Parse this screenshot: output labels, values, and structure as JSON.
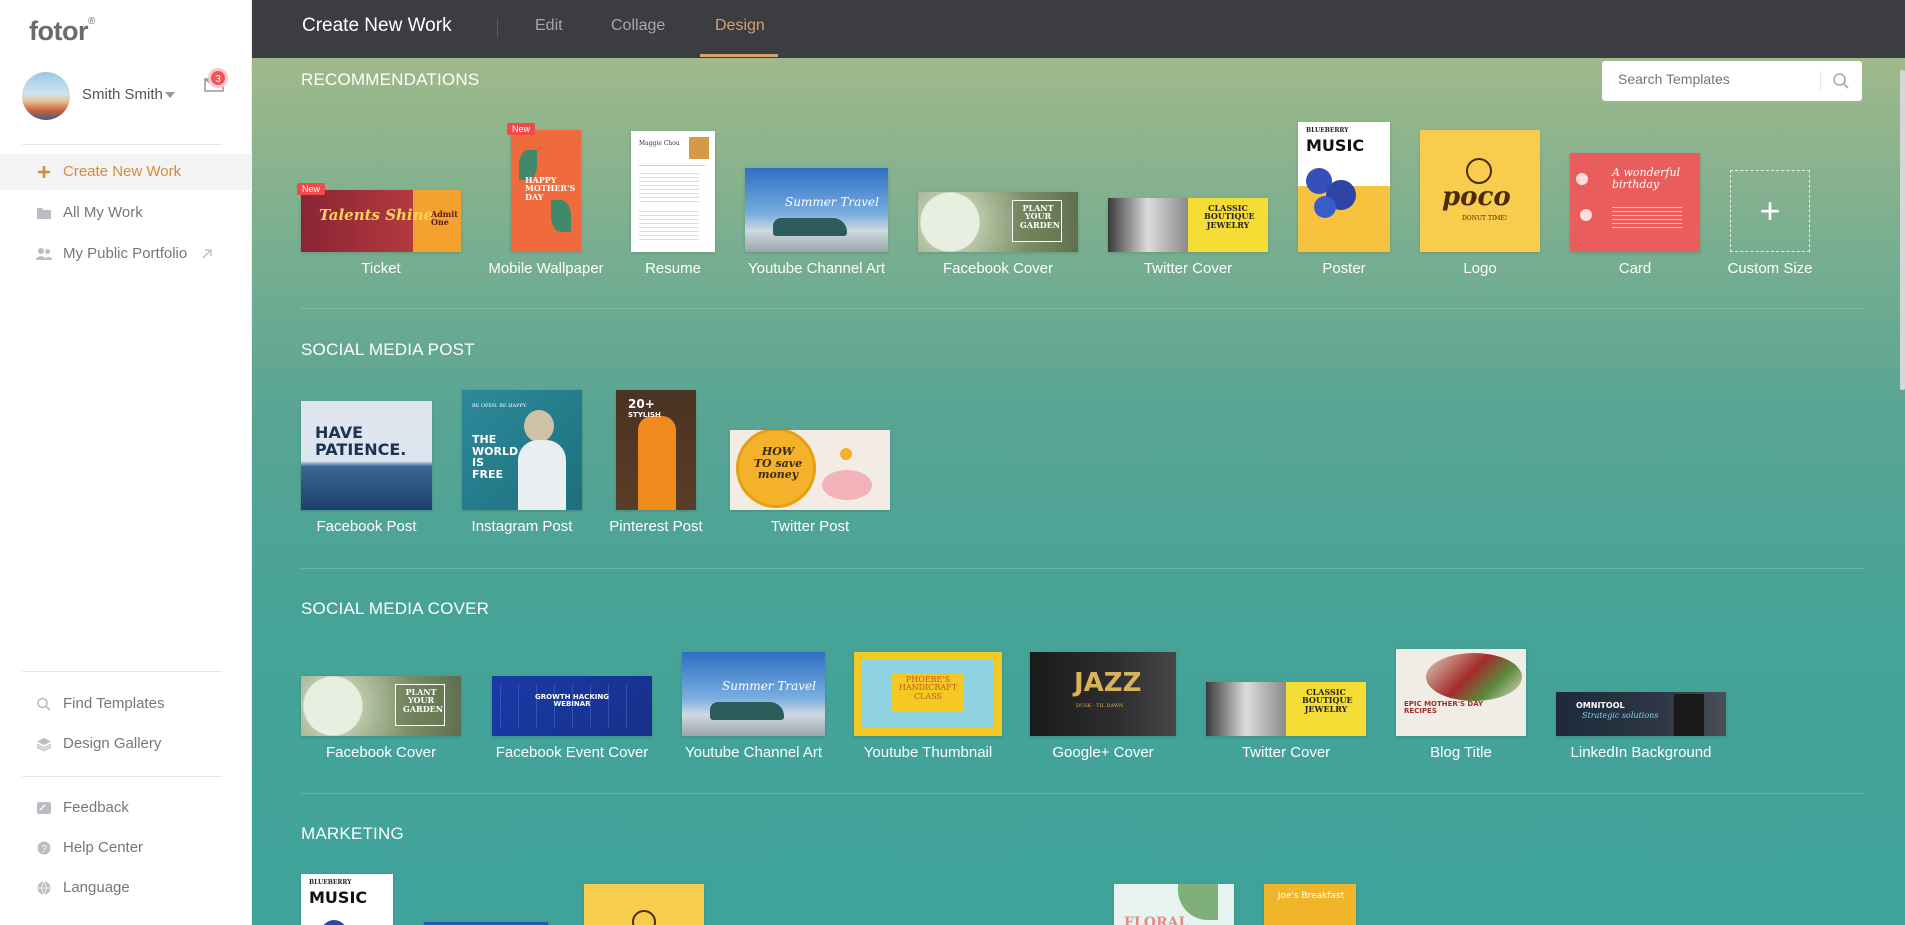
{
  "app": {
    "logo": "fotor",
    "logo_mark": "®"
  },
  "user": {
    "name": "Smith Smith",
    "unread_count": "3"
  },
  "sidebar": {
    "items": [
      {
        "label": "Create New Work",
        "icon": "plus-icon"
      },
      {
        "label": "All My Work",
        "icon": "folder-icon"
      },
      {
        "label": "My Public Portfolio",
        "icon": "users-icon"
      }
    ],
    "bottom_items": [
      {
        "label": "Find Templates",
        "icon": "search-icon"
      },
      {
        "label": "Design Gallery",
        "icon": "layers-icon"
      },
      {
        "label": "Feedback",
        "icon": "feedback-icon"
      },
      {
        "label": "Help Center",
        "icon": "help-icon"
      },
      {
        "label": "Language",
        "icon": "globe-icon"
      }
    ]
  },
  "topbar": {
    "title": "Create New Work",
    "tabs": [
      {
        "label": "Edit"
      },
      {
        "label": "Collage"
      },
      {
        "label": "Design"
      }
    ],
    "active_tab": "Design"
  },
  "search": {
    "placeholder": "Search Templates"
  },
  "sections": [
    {
      "title": "RECOMMENDATIONS",
      "items": [
        {
          "label": "Ticket",
          "badge": "New",
          "thumb_text": "Talents Shine",
          "thumb_text2": "Admit One"
        },
        {
          "label": "Mobile Wallpaper",
          "badge": "New",
          "thumb_text": "HAPPY MOTHER'S DAY"
        },
        {
          "label": "Resume",
          "thumb_text": "Maggie Chou"
        },
        {
          "label": "Youtube Channel Art",
          "thumb_text": "Summer Travel"
        },
        {
          "label": "Facebook Cover",
          "thumb_text": "PLANT YOUR GARDEN"
        },
        {
          "label": "Twitter Cover",
          "thumb_text": "CLASSIC BOUTIQUE JEWELRY"
        },
        {
          "label": "Poster",
          "thumb_text": "BLUEBERRY",
          "thumb_text2": "MUSIC"
        },
        {
          "label": "Logo",
          "thumb_text": "poco",
          "thumb_text2": "DONUT TIME!"
        },
        {
          "label": "Card",
          "thumb_text": "A wonderful birthday"
        },
        {
          "label": "Custom Size"
        }
      ]
    },
    {
      "title": "SOCIAL MEDIA POST",
      "items": [
        {
          "label": "Facebook Post",
          "thumb_text": "HAVE PATIENCE."
        },
        {
          "label": "Instagram Post",
          "thumb_text": "THE WORLD IS FREE",
          "thumb_text2": "BE OPEN. BE HAPPY."
        },
        {
          "label": "Pinterest Post",
          "thumb_text": "20+",
          "thumb_text2": "STYLISH"
        },
        {
          "label": "Twitter Post",
          "thumb_text": "HOW TO save money"
        }
      ]
    },
    {
      "title": "SOCIAL MEDIA COVER",
      "items": [
        {
          "label": "Facebook Cover",
          "thumb_text": "PLANT YOUR GARDEN"
        },
        {
          "label": "Facebook Event Cover",
          "thumb_text": "GROWTH HACKING WEBINAR"
        },
        {
          "label": "Youtube Channel Art",
          "thumb_text": "Summer Travel"
        },
        {
          "label": "Youtube Thumbnail",
          "thumb_text": "PHOEBE'S HANDICRAFT CLASS"
        },
        {
          "label": "Google+ Cover",
          "thumb_text": "JAZZ",
          "thumb_text2": "DUSK · TIL DAWN"
        },
        {
          "label": "Twitter Cover",
          "thumb_text": "CLASSIC BOUTIQUE JEWELRY"
        },
        {
          "label": "Blog Title",
          "thumb_text": "EPIC MOTHER'S DAY RECIPES"
        },
        {
          "label": "LinkedIn Background",
          "thumb_text": "OMNITOOL",
          "thumb_text2": "Strategic solutions"
        }
      ]
    },
    {
      "title": "MARKETING",
      "items": [
        {
          "thumb_text": "BLUEBERRY",
          "thumb_text2": "MUSIC"
        },
        {
          "thumb_text": ""
        },
        {
          "thumb_text": ""
        },
        {
          "thumb_text": "FLORAL"
        },
        {
          "thumb_text": "Joe's Breakfast"
        }
      ]
    }
  ]
}
